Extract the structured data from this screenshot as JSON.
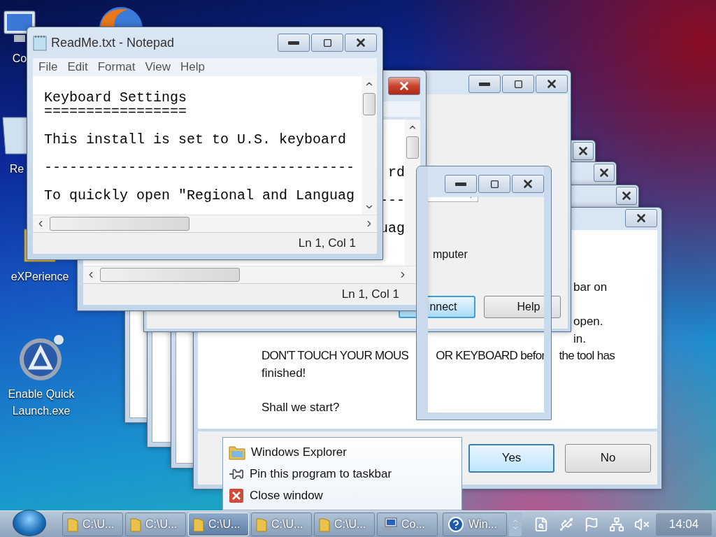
{
  "desktop": {
    "icons": [
      {
        "label": "Co",
        "kind": "computer"
      },
      {
        "label": "Re",
        "kind": "bin"
      },
      {
        "label": "eXPerience",
        "kind": "folder"
      },
      {
        "label": "Enable Quick Launch.exe",
        "kind": "app"
      }
    ]
  },
  "message_dialog": {
    "paragraphs": [
      [
        {
          "text": "bar on",
          "kind": "tail"
        }
      ],
      [
        {
          "text": "open.",
          "kind": "tail"
        },
        {
          "text": "in.",
          "kind": "tail"
        },
        {
          "parts": [
            "DON'T TOUCH YOUR MOUS",
            "OR KEYBOARD befor",
            "the tool has"
          ],
          "kind": "split"
        },
        {
          "text": "finished!",
          "kind": "full"
        }
      ],
      [
        {
          "text": "Shall we start?",
          "kind": "full"
        }
      ]
    ],
    "buttons": [
      {
        "label": "Yes",
        "selected": true
      },
      {
        "label": "No",
        "selected": false
      }
    ]
  },
  "connect_window": {
    "computer_label": "mputer",
    "buttons": [
      {
        "label": "nnect",
        "selected": true
      },
      {
        "label": "Help",
        "selected": false
      }
    ]
  },
  "notepad_back": {
    "active": true,
    "lines": [
      "rd",
      "---",
      "uag"
    ],
    "status": "Ln 1, Col 1"
  },
  "notepad": {
    "title": "ReadMe.txt - Notepad",
    "menu": [
      "File",
      "Edit",
      "Format",
      "View",
      "Help"
    ],
    "paragraphs": [
      [
        "Keyboard Settings",
        "================="
      ],
      [
        "This install is set to U.S. keyboard"
      ],
      [
        "-------------------------------------"
      ],
      [
        "To quickly open \"Regional and Languag"
      ]
    ],
    "status": "Ln 1, Col 1"
  },
  "jump_list": {
    "items": [
      {
        "label": "Windows Explorer",
        "kind": "folder"
      },
      {
        "label": "Pin this program to taskbar",
        "kind": "pin"
      },
      {
        "label": "Close window",
        "kind": "close"
      }
    ]
  },
  "taskbar": {
    "buttons": [
      {
        "label": "C:\\U...",
        "kind": "folder",
        "selected": false
      },
      {
        "label": "C:\\U...",
        "kind": "folder",
        "selected": false
      },
      {
        "label": "C:\\U...",
        "kind": "folder",
        "selected": true
      },
      {
        "label": "C:\\U...",
        "kind": "folder",
        "selected": false
      },
      {
        "label": "C:\\U...",
        "kind": "folder",
        "selected": false
      },
      {
        "label": "Co...",
        "kind": "computer",
        "selected": false
      },
      {
        "label": "Win...",
        "kind": "help",
        "selected": false
      }
    ],
    "clock": "14:04"
  }
}
